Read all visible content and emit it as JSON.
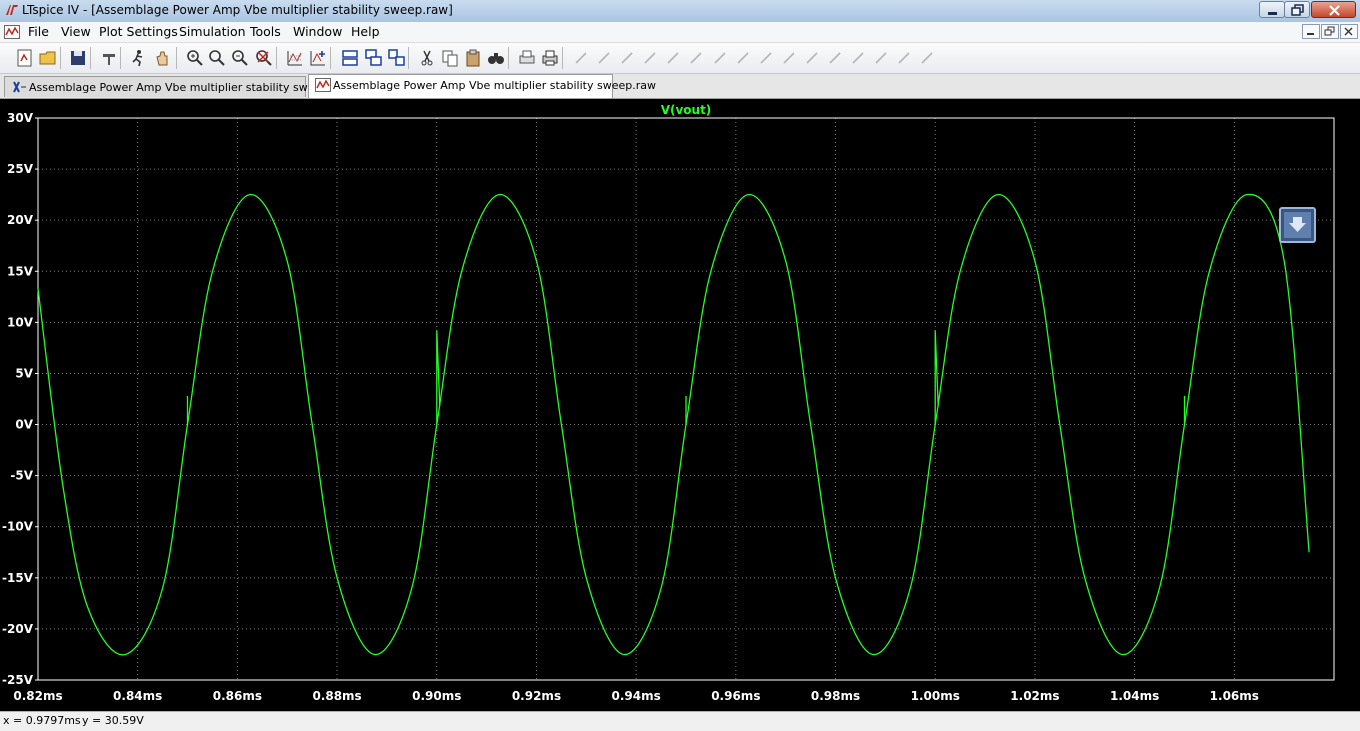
{
  "window": {
    "title": "LTspice IV - [Assemblage Power Amp Vbe multiplier stability sweep.raw]"
  },
  "menu": {
    "items": [
      "File",
      "View",
      "Plot Settings",
      "Simulation",
      "Tools",
      "Window",
      "Help"
    ]
  },
  "toolbar": {
    "icons": [
      "new-schematic-icon",
      "open-icon",
      "save-icon",
      "control-panel-icon",
      "run-icon",
      "halt-icon",
      "zoom-in-icon",
      "zoom-area-icon",
      "zoom-out-icon",
      "zoom-full-icon",
      "autorange-icon",
      "add-trace-icon",
      "tile-horizontal-icon",
      "cascade-icon",
      "tile-vertical-icon",
      "cut-icon",
      "copy-icon",
      "paste-icon",
      "find-icon",
      "print-preview-icon",
      "print-icon",
      "draw-wire-icon",
      "ground-icon",
      "label-icon",
      "resistor-icon",
      "capacitor-icon",
      "inductor-icon",
      "diode-icon",
      "component-icon",
      "move-icon",
      "drag-icon",
      "undo-icon",
      "redo-icon",
      "rotate-icon",
      "mirror-icon",
      "text-icon",
      "spice-directive-icon"
    ]
  },
  "tabs": [
    {
      "label": "Assemblage Power Amp Vbe multiplier stability sweep.asc",
      "active": false
    },
    {
      "label": "Assemblage Power Amp Vbe multiplier stability sweep.raw",
      "active": true
    }
  ],
  "plot": {
    "trace_color": "#22ff22",
    "background": "#000000",
    "grid_color": "#7f7f7f"
  },
  "chart_data": {
    "type": "line",
    "title": "V(vout)",
    "xlabel": "",
    "ylabel": "",
    "xlim": [
      0.82,
      1.08
    ],
    "ylim": [
      -25,
      30
    ],
    "x_ticks": [
      "0.82ms",
      "0.84ms",
      "0.86ms",
      "0.88ms",
      "0.90ms",
      "0.92ms",
      "0.94ms",
      "0.96ms",
      "0.98ms",
      "1.00ms",
      "1.02ms",
      "1.04ms",
      "1.06ms"
    ],
    "y_ticks": [
      "30V",
      "25V",
      "20V",
      "15V",
      "10V",
      "5V",
      "0V",
      "-5V",
      "-10V",
      "-15V",
      "-20V",
      "-25V"
    ],
    "grid": true,
    "series": [
      {
        "name": "V(vout)",
        "x": [
          0.82,
          0.825,
          0.83,
          0.8375,
          0.845,
          0.85,
          0.855,
          0.8625,
          0.87,
          0.875,
          0.88,
          0.8875,
          0.895,
          0.9,
          0.905,
          0.9125,
          0.92,
          0.925,
          0.93,
          0.9375,
          0.945,
          0.95,
          0.955,
          0.9625,
          0.97,
          0.975,
          0.98,
          0.9875,
          0.995,
          1.0,
          1.005,
          1.0125,
          1.02,
          1.025,
          1.03,
          1.0375,
          1.045,
          1.05,
          1.055,
          1.0625,
          1.07,
          1.075
        ],
        "values": [
          13.3,
          -6.0,
          -17.9,
          -22.5,
          -16.0,
          0.0,
          15.0,
          22.5,
          16.0,
          0.0,
          -15.0,
          -22.5,
          -16.0,
          0.0,
          15.0,
          22.5,
          16.0,
          0.0,
          -15.0,
          -22.5,
          -16.0,
          0.0,
          15.0,
          22.5,
          16.0,
          0.0,
          -15.0,
          -22.5,
          -16.0,
          0.0,
          15.0,
          22.5,
          16.0,
          0.0,
          -15.0,
          -22.5,
          -16.0,
          0.0,
          15.0,
          22.5,
          16.0,
          -12.5
        ]
      }
    ],
    "glitches": [
      {
        "x": 0.85,
        "values": [
          0.0,
          2.8
        ]
      },
      {
        "x": 0.9,
        "values": [
          0.0,
          9.2,
          1.8
        ]
      },
      {
        "x": 0.95,
        "values": [
          0.0,
          2.8
        ]
      },
      {
        "x": 1.0,
        "values": [
          0.0,
          9.2,
          1.8
        ]
      },
      {
        "x": 1.05,
        "values": [
          0.0,
          2.8
        ]
      }
    ]
  },
  "status": {
    "x_readout": "x = 0.9797ms",
    "y_readout": "y = 30.59V"
  }
}
